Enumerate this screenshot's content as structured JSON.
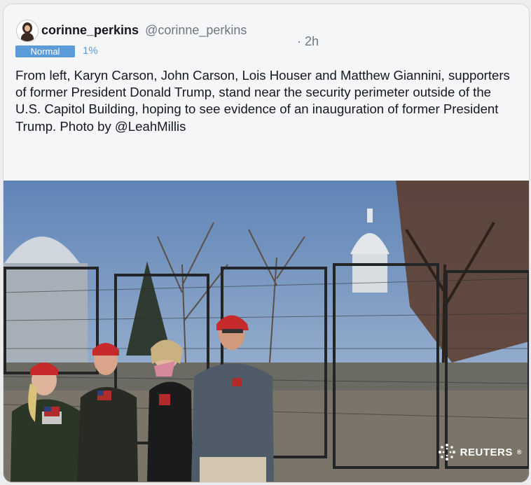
{
  "tweet": {
    "display_name": "corinne_perkins",
    "handle": "@corinne_perkins",
    "time": "· 2h",
    "badge": "Normal",
    "percent": "1%",
    "text": "From left, Karyn Carson, John Carson, Lois Houser and Matthew Giannini, supporters of former President Donald Trump, stand near the security perimeter outside of the U.S. Capitol Building, hoping to see evidence of an inauguration of former President Trump. Photo by @LeahMillis"
  },
  "photo": {
    "credit": "REUTERS",
    "credit_suffix": "®"
  },
  "icons": {
    "avatar": "user-avatar",
    "reuters_logo": "reuters-dots-icon"
  }
}
